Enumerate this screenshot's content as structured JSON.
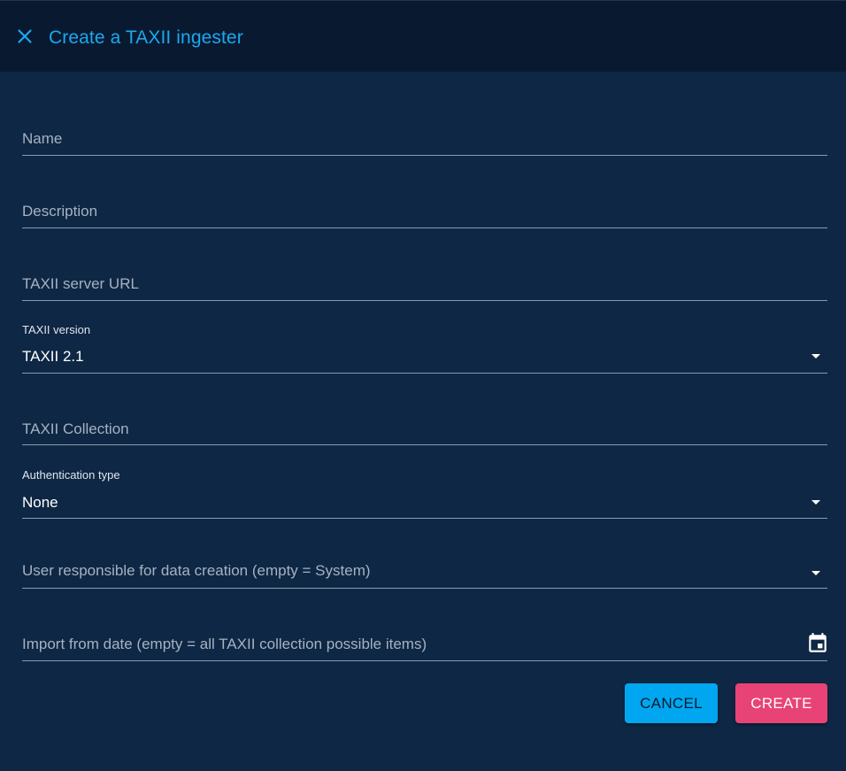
{
  "dialog": {
    "title": "Create a TAXII ingester"
  },
  "icons": {
    "close": "close-icon",
    "dropdown": "arrow-drop-down-icon",
    "calendar": "calendar-icon"
  },
  "form": {
    "name": {
      "placeholder": "Name"
    },
    "description": {
      "placeholder": "Description"
    },
    "server_url": {
      "placeholder": "TAXII server URL"
    },
    "version": {
      "label": "TAXII version",
      "value": "TAXII 2.1"
    },
    "collection": {
      "placeholder": "TAXII Collection"
    },
    "auth_type": {
      "label": "Authentication type",
      "value": "None"
    },
    "user": {
      "placeholder": "User responsible for data creation (empty = System)"
    },
    "import_date": {
      "placeholder": "Import from date (empty = all TAXII collection possible items)"
    }
  },
  "actions": {
    "cancel_label": "CANCEL",
    "create_label": "CREATE"
  },
  "colors": {
    "background": "#0e2744",
    "header": "#091a30",
    "accent": "#1ba8f0",
    "cancel_button": "#00a7f0",
    "create_button": "#e84376"
  }
}
